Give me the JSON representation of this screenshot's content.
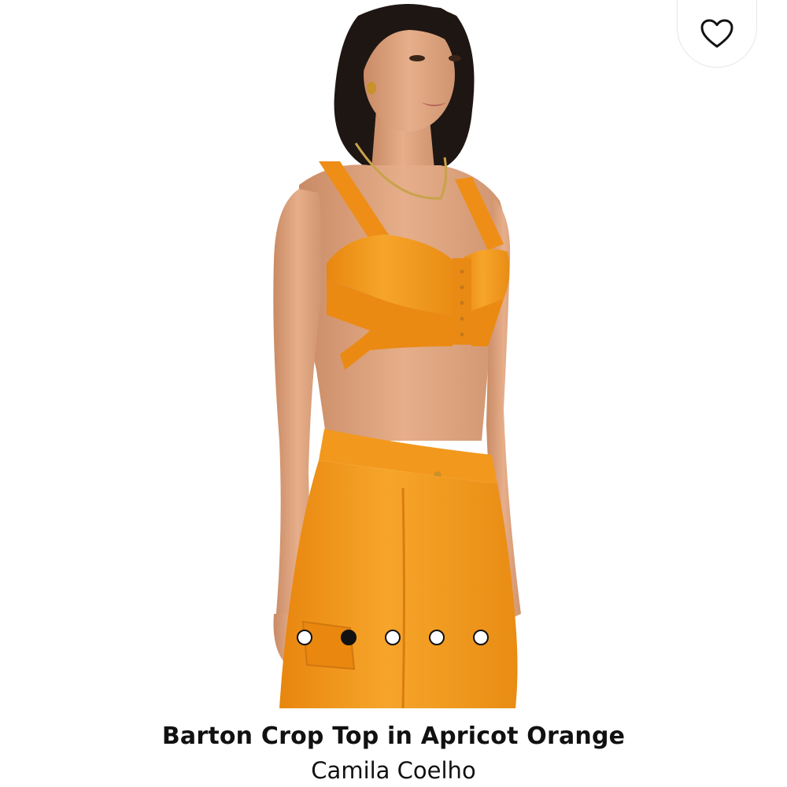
{
  "product": {
    "title": "Barton Crop Top in Apricot Orange",
    "brand": "Camila Coelho"
  },
  "image": {
    "description_icon": "product-photo",
    "garment_color": "#F39A1E",
    "skin_color": "#DDA07C",
    "hair_color": "#1E1612"
  },
  "favorite": {
    "icon": "heart-outline-icon"
  },
  "pager": {
    "count": 5,
    "active_index": 1
  }
}
